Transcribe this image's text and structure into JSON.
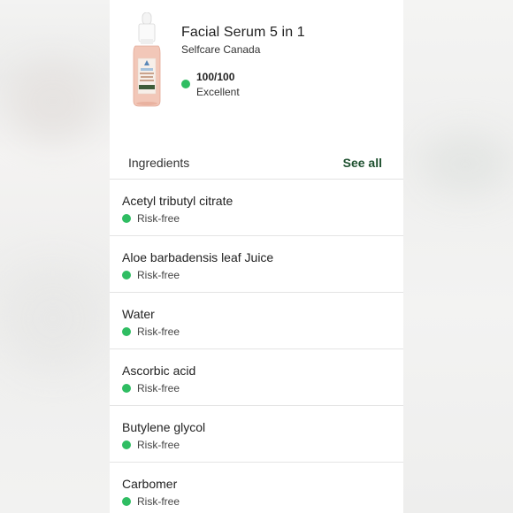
{
  "product": {
    "name": "Facial Serum 5 in 1",
    "brand": "Selfcare Canada",
    "score": "100/100",
    "rating": "Excellent",
    "rating_color": "#2fbd62"
  },
  "ingredients": {
    "title": "Ingredients",
    "see_all": "See all",
    "items": [
      {
        "name": "Acetyl tributyl citrate",
        "risk": "Risk-free"
      },
      {
        "name": "Aloe barbadensis leaf Juice",
        "risk": "Risk-free"
      },
      {
        "name": "Water",
        "risk": "Risk-free"
      },
      {
        "name": "Ascorbic acid",
        "risk": "Risk-free"
      },
      {
        "name": "Butylene glycol",
        "risk": "Risk-free"
      },
      {
        "name": "Carbomer",
        "risk": "Risk-free"
      }
    ]
  },
  "colors": {
    "accent": "#1f5130",
    "risk_free": "#2fbd62"
  }
}
